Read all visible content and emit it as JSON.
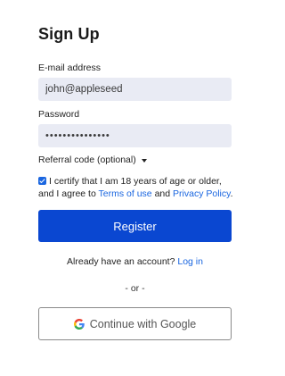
{
  "form": {
    "title": "Sign Up",
    "email_label": "E-mail address",
    "email_value": "john@appleseed",
    "password_label": "Password",
    "password_value": "•••••••••••••••",
    "referral_label": "Referral code (optional)",
    "certify_prefix": "I certify that I am 18 years of age or older, and I agree to",
    "terms_link": "Terms of use",
    "and_text": "and",
    "privacy_link": "Privacy Policy",
    "period": ".",
    "register_label": "Register",
    "already_text": "Already have an account?",
    "login_link": "Log in",
    "or_text": "- or -",
    "google_label": "Continue with Google",
    "google_icon": "google-g-icon",
    "certify_checked": true
  },
  "colors": {
    "accent": "#0a47d1",
    "link": "#1a66e0",
    "input_bg": "#e9ebf4"
  }
}
